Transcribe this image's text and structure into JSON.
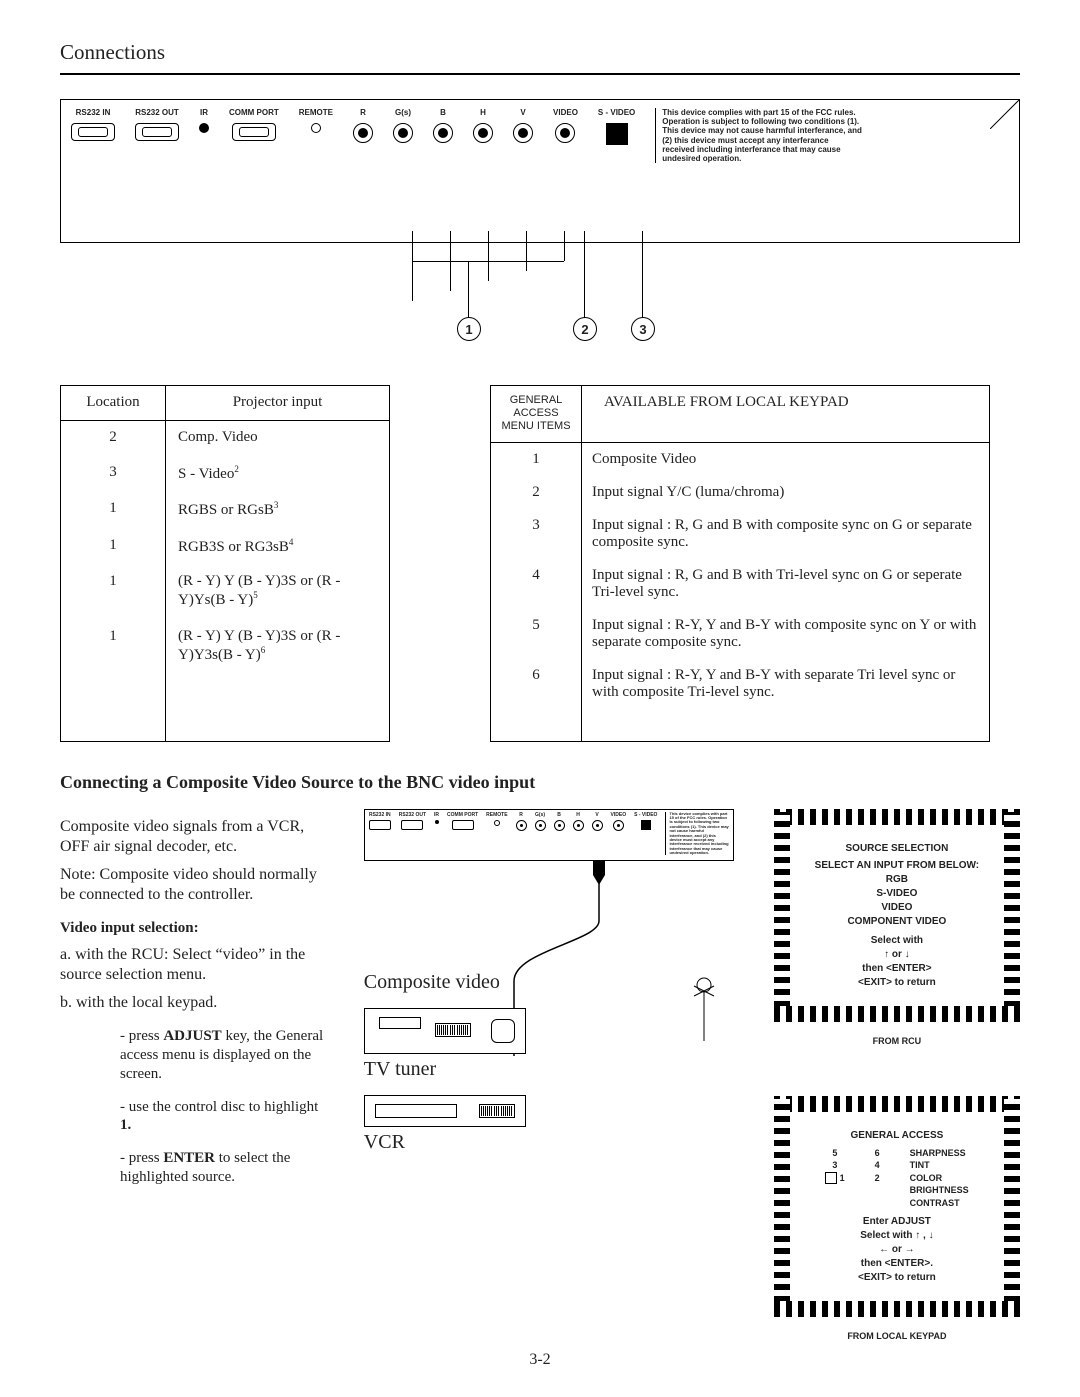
{
  "header": {
    "title": "Connections"
  },
  "panel": {
    "ports": [
      "RS232 IN",
      "RS232 OUT",
      "IR",
      "COMM PORT",
      "REMOTE",
      "R",
      "G(s)",
      "B",
      "H",
      "V",
      "VIDEO",
      "S - VIDEO"
    ],
    "fcc": "This device complies with part 15 of the FCC rules. Operation is subject to following two conditions (1). This device may not cause harmful interferance, and (2) this device must accept any interferance received including interferance that may cause undesired operation."
  },
  "nodes": {
    "n1": "1",
    "n2": "2",
    "n3": "3"
  },
  "loc_table": {
    "h1": "Location",
    "h2": "Projector input",
    "rows": [
      {
        "loc": "2",
        "inp": "Comp. Video",
        "sup": ""
      },
      {
        "loc": "3",
        "inp": "S - Video",
        "sup": "2"
      },
      {
        "loc": "1",
        "inp": "RGBS or RGsB",
        "sup": "3"
      },
      {
        "loc": "1",
        "inp": "RGB3S or RG3sB",
        "sup": "4"
      },
      {
        "loc": "1",
        "inp": "(R - Y) Y (B - Y)3S or (R - Y)Ys(B - Y)",
        "sup": "5"
      },
      {
        "loc": "1",
        "inp": "(R - Y) Y (B - Y)3S or (R - Y)Y3s(B - Y)",
        "sup": "6"
      }
    ]
  },
  "menu_table": {
    "h1": "GENERAL ACCESS MENU ITEMS",
    "h2": "AVAILABLE FROM LOCAL KEYPAD",
    "rows": [
      {
        "n": "1",
        "t": "Composite Video"
      },
      {
        "n": "2",
        "t": "Input signal Y/C (luma/chroma)"
      },
      {
        "n": "3",
        "t": "Input signal : R, G and B with composite sync on G or separate composite sync."
      },
      {
        "n": "4",
        "t": "Input signal : R, G and B with Tri-level sync on G or seperate Tri-level sync."
      },
      {
        "n": "5",
        "t": "Input signal : R-Y, Y and B-Y with composite sync on Y or with separate composite sync."
      },
      {
        "n": "6",
        "t": "Input signal : R-Y, Y and B-Y with separate Tri level sync or with composite Tri-level sync."
      }
    ]
  },
  "section2_title": "Connecting a Composite Video Source to the BNC video input",
  "left": {
    "p1": "Composite video signals from a VCR, OFF air signal decoder, etc.",
    "p2": "Note:  Composite video should normally be connected to the controller.",
    "sub": "Video input selection:",
    "a": "a. with the RCU: Select “video” in the source selection menu.",
    "b": "b. with the local keypad.",
    "s1a": "- press ",
    "s1b": "ADJUST",
    "s1c": " key, the General access menu is displayed on the screen.",
    "s2a": "- use the control disc to highlight ",
    "s2b": "1.",
    "s3a": "- press ",
    "s3b": "ENTER",
    "s3c": " to select the highlighted source."
  },
  "mid": {
    "compv": "Composite video",
    "tvtuner": "TV tuner",
    "vcr": "VCR"
  },
  "osd1": {
    "title": "SOURCE SELECTION",
    "sub": "SELECT AN INPUT FROM BELOW:",
    "opts": [
      "RGB",
      "S-VIDEO",
      "VIDEO",
      "COMPONENT VIDEO"
    ],
    "hint1": "Select with",
    "hint2": "↑ or ↓",
    "hint3": "then <ENTER>",
    "hint4": "<EXIT> to return",
    "caption": "FROM RCU"
  },
  "osd2": {
    "title": "GENERAL ACCESS",
    "nums": {
      "c1": [
        "5",
        "3",
        "1"
      ],
      "c2": [
        "6",
        "4",
        "2"
      ]
    },
    "opts": [
      "SHARPNESS",
      "TINT",
      "COLOR",
      "BRIGHTNESS",
      "CONTRAST"
    ],
    "hint0": "Enter ADJUST",
    "hint1": "Select with ↑ , ↓",
    "hint2": "← or →",
    "hint3": "then <ENTER>.",
    "hint4": "<EXIT> to return",
    "caption": "FROM LOCAL KEYPAD"
  },
  "pagenum": "3-2"
}
